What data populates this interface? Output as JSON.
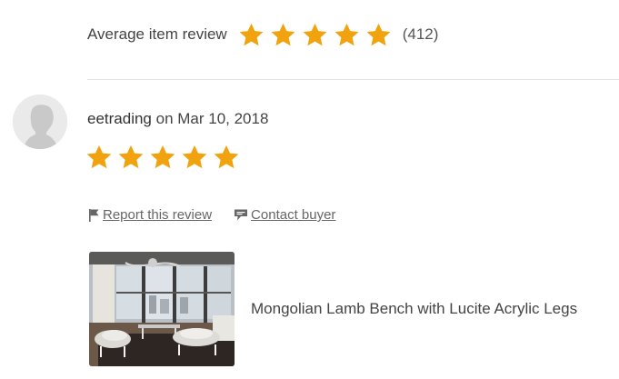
{
  "average_review": {
    "label": "Average item review",
    "rating": 5,
    "max_rating": 5,
    "count": "(412)"
  },
  "review": {
    "reviewer": "eetrading",
    "date_prefix": " on Mar 10, 2018",
    "rating": 5,
    "max_rating": 5,
    "actions": {
      "report": "Report this review",
      "contact": "Contact buyer"
    },
    "item": {
      "title": "Mongolian Lamb Bench with Lucite Acrylic Legs"
    }
  },
  "colors": {
    "star": "#f1a30f",
    "text": "#444444",
    "link": "#666666",
    "divider": "#e1e1e1",
    "avatar_bg": "#eaeaea",
    "avatar_silhouette": "#c9c9c9"
  },
  "icons": {
    "star": "star-icon",
    "report": "flag-icon",
    "contact": "speech-bubble-icon"
  }
}
